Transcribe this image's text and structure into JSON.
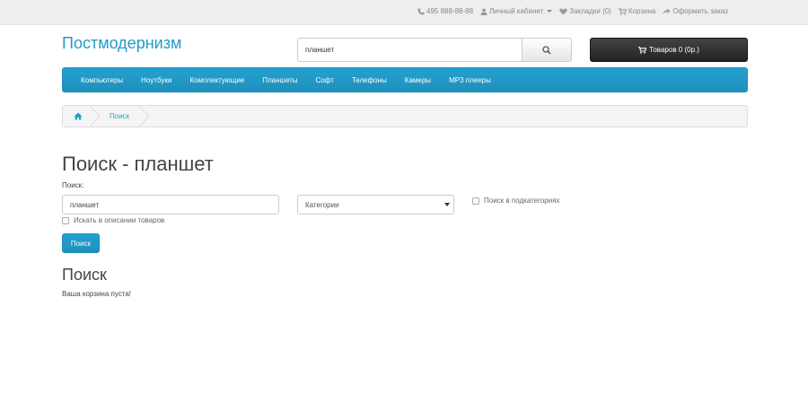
{
  "topbar": {
    "phone": "495 888-88-88",
    "account": "Личный кабинет",
    "wishlist": "Закладки (0)",
    "cart": "Корзина",
    "checkout": "Оформить заказ"
  },
  "header": {
    "logo": "Постмодернизм",
    "search_value": "планшет",
    "cart_button": "Товаров 0 (0р.)"
  },
  "menu": {
    "items": [
      "Компьютеры",
      "Ноутбуки",
      "Комплектующие",
      "Планшеты",
      "Софт",
      "Телефоны",
      "Камеры",
      "MP3 плееры"
    ]
  },
  "breadcrumb": {
    "current": "Поиск"
  },
  "main": {
    "title": "Поиск - планшет",
    "search_label": "Поиск:",
    "search_value": "планшет",
    "category_selected": "Категории",
    "subcategory_checkbox": "Поиск в подкатегориях",
    "description_checkbox": "Искать в описании товаров",
    "search_button": "Поиск",
    "results_title": "Поиск",
    "empty_message": "Ваша корзина пуста!"
  },
  "colors": {
    "accent": "#229ac8",
    "cart_button_bg": "#333333",
    "topbar_bg": "#eeeeee"
  }
}
